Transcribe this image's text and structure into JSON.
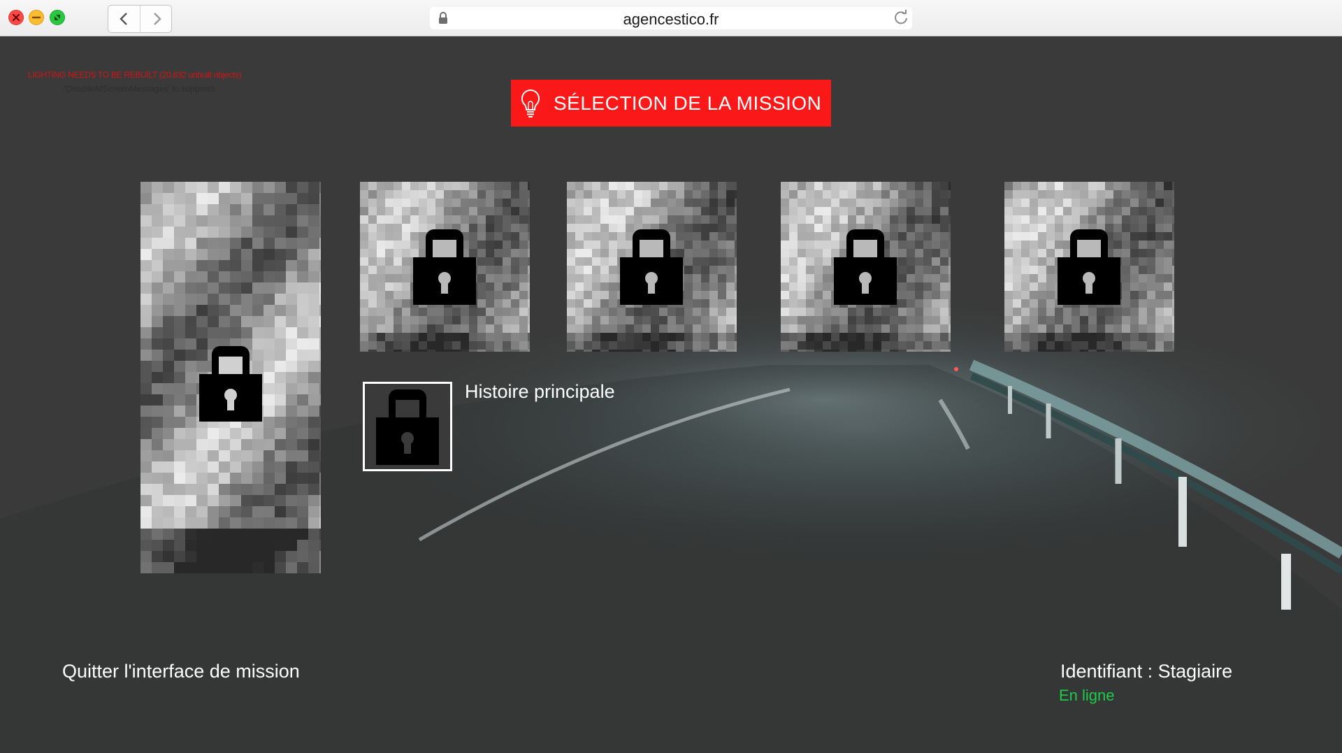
{
  "browser": {
    "url": "agencestico.fr"
  },
  "debug": {
    "line1": "LIGHTING NEEDS TO BE REBUILT (20,832 unbuilt objects)",
    "line2": "'DisableAllScreenMessages' to suppress"
  },
  "header": {
    "title": "SÉLECTION DE LA MISSION",
    "icon": "lightbulb-icon",
    "accent_color": "#fb1818"
  },
  "missions": {
    "tiles": [
      {
        "name": "mission-tile-1",
        "locked": true
      },
      {
        "name": "mission-tile-2",
        "locked": true
      },
      {
        "name": "mission-tile-3",
        "locked": true
      },
      {
        "name": "mission-tile-4",
        "locked": true
      },
      {
        "name": "mission-tile-5",
        "locked": true
      }
    ],
    "featured": {
      "locked": true
    },
    "main_story_label": "Histoire principale"
  },
  "footer": {
    "quit_label": "Quitter l'interface de mission",
    "user_label": "Identifiant : Stagiaire",
    "status_label": "En ligne",
    "status_color": "#1ecb4a"
  }
}
